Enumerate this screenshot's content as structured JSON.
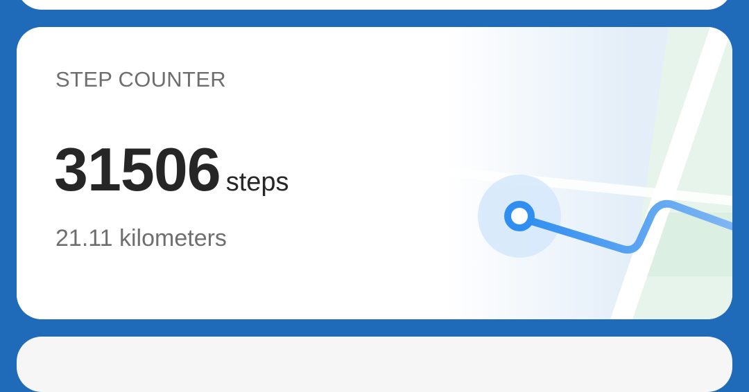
{
  "step_card": {
    "title": "STEP COUNTER",
    "steps_value": "31506",
    "steps_unit": "steps",
    "distance": "21.11 kilometers"
  },
  "colors": {
    "background": "#1f6bb9",
    "card": "#ffffff",
    "route": "#4a97ea",
    "accent_pale": "#dbeaf8"
  }
}
